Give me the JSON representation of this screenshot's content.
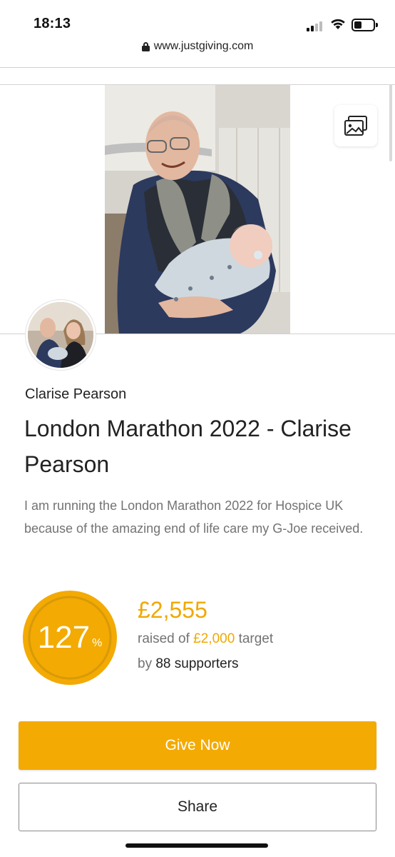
{
  "status_bar": {
    "time": "18:13"
  },
  "browser": {
    "url": "www.justgiving.com"
  },
  "fundraiser": {
    "owner_name": "Clarise Pearson",
    "title": "London Marathon 2022 - Clarise Pearson",
    "summary": "I am running the London Marathon 2022 for Hospice UK because of the amazing end of life care my G-Joe received."
  },
  "progress": {
    "percent": "127",
    "percent_symbol": "%",
    "percent_value": 127,
    "raised": "£2,555",
    "raised_prefix": "raised of",
    "target": "£2,000",
    "target_suffix": "target",
    "supporters_prefix": "by",
    "supporters": "88 supporters"
  },
  "actions": {
    "give_label": "Give Now",
    "share_label": "Share"
  },
  "icons": {
    "gallery": "image-gallery-icon",
    "lock": "lock-icon"
  },
  "colors": {
    "accent": "#f3aa02",
    "accent_text": "#f0a800"
  }
}
